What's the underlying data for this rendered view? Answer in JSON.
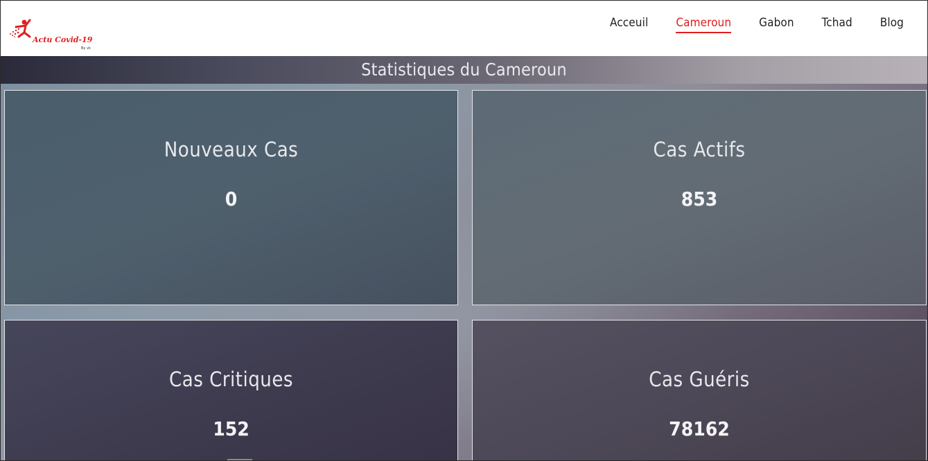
{
  "brand": {
    "logo_text": "Actu Covid-19",
    "logo_sub": "By vk",
    "accent_color": "#e31c1c"
  },
  "nav": {
    "items": [
      {
        "label": "Acceuil",
        "active": false
      },
      {
        "label": "Cameroun",
        "active": true
      },
      {
        "label": "Gabon",
        "active": false
      },
      {
        "label": "Tchad",
        "active": false
      },
      {
        "label": "Blog",
        "active": false
      }
    ]
  },
  "page": {
    "title": "Statistiques du Cameroun"
  },
  "stats": [
    {
      "label": "Nouveaux Cas",
      "value": "0"
    },
    {
      "label": "Cas Actifs",
      "value": "853"
    },
    {
      "label": "Cas Critiques",
      "value": "152"
    },
    {
      "label": "Cas Guéris",
      "value": "78162"
    }
  ]
}
